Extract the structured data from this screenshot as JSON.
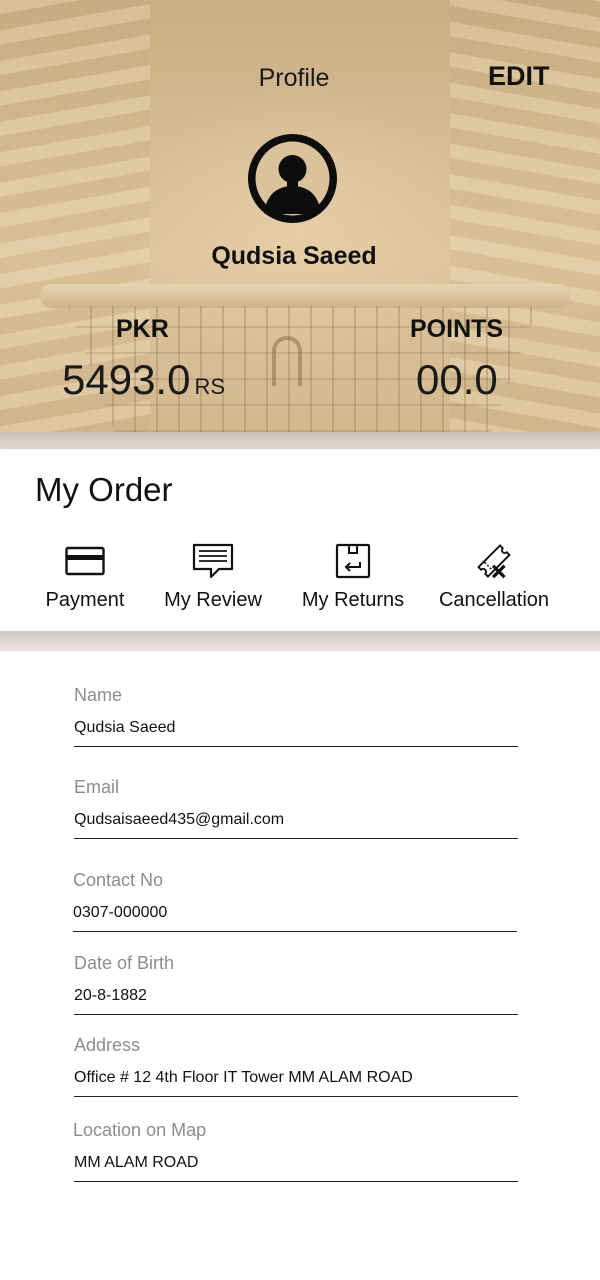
{
  "header": {
    "title": "Profile",
    "edit_label": "EDIT",
    "user_name": "Qudsia Saeed",
    "pkr_label": "PKR",
    "pkr_value": "5493.0",
    "pkr_unit": "RS",
    "points_label": "POINTS",
    "points_value": "00.0"
  },
  "orders": {
    "title": "My Order",
    "actions": [
      {
        "label": "Payment",
        "icon": "credit-card-icon"
      },
      {
        "label": "My Review",
        "icon": "chat-bubble-icon"
      },
      {
        "label": "My Returns",
        "icon": "return-box-icon"
      },
      {
        "label": "Cancellation",
        "icon": "cancel-ticket-icon"
      }
    ]
  },
  "form": {
    "name": {
      "label": "Name",
      "value": "Qudsia Saeed"
    },
    "email": {
      "label": "Email",
      "value": "Qudsaisaeed435@gmail.com"
    },
    "contact": {
      "label": "Contact No",
      "value": "0307-000000"
    },
    "dob": {
      "label": "Date of Birth",
      "value": "20-8-1882"
    },
    "address": {
      "label": "Address",
      "value": "Office # 12 4th Floor IT Tower MM ALAM ROAD"
    },
    "location": {
      "label": "Location on Map",
      "value": "MM ALAM ROAD"
    }
  }
}
